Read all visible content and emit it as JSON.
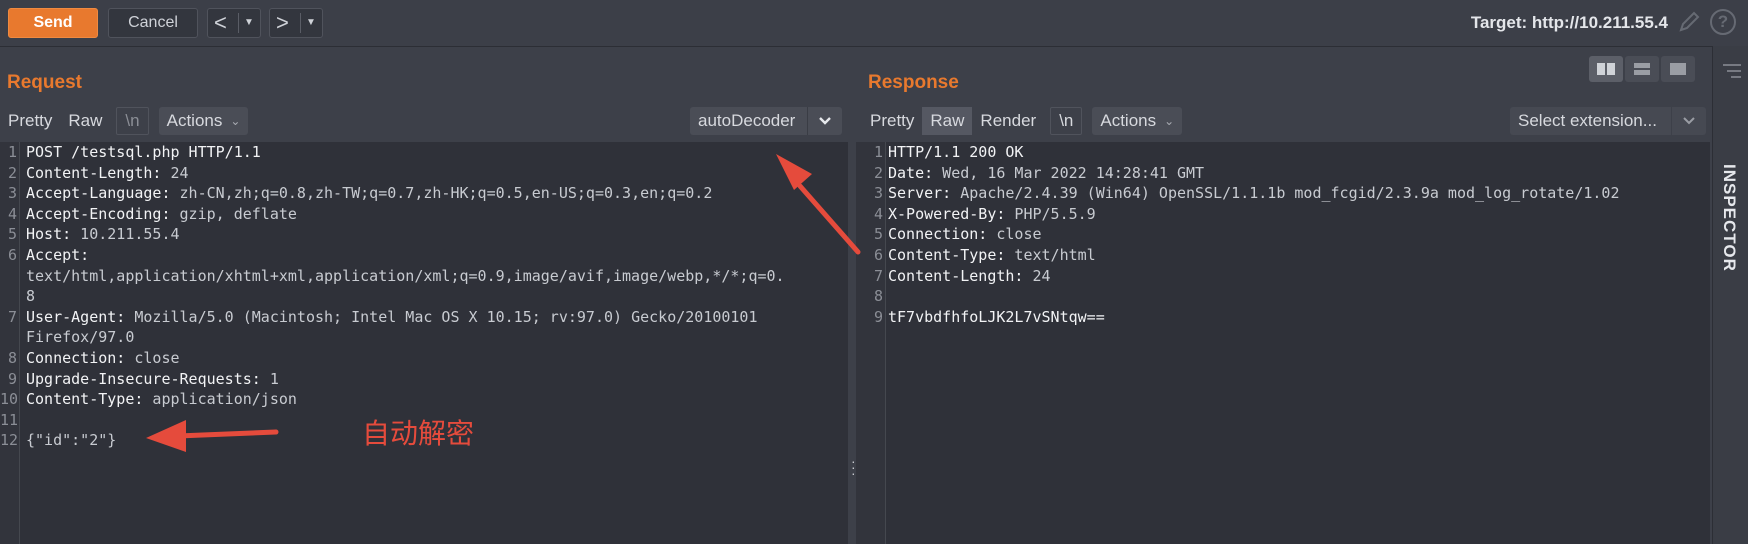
{
  "toolbar": {
    "send_label": "Send",
    "cancel_label": "Cancel",
    "back_glyph": "<",
    "forward_glyph": ">",
    "dropdown_glyph": "▼",
    "target_label": "Target: http://10.211.55.4",
    "help_glyph": "?"
  },
  "request": {
    "title": "Request",
    "tabs": [
      "Pretty",
      "Raw",
      "\\n"
    ],
    "actions_label": "Actions",
    "decoder_label": "autoDecoder",
    "lines": [
      {
        "n": "1",
        "key": "POST /testsql.php HTTP/1.1",
        "val": ""
      },
      {
        "n": "2",
        "key": "Content-Length:",
        "val": " 24"
      },
      {
        "n": "3",
        "key": "Accept-Language:",
        "val": " zh-CN,zh;q=0.8,zh-TW;q=0.7,zh-HK;q=0.5,en-US;q=0.3,en;q=0.2"
      },
      {
        "n": "4",
        "key": "Accept-Encoding:",
        "val": " gzip, deflate"
      },
      {
        "n": "5",
        "key": "Host:",
        "val": " 10.211.55.4"
      },
      {
        "n": "6",
        "key": "Accept:",
        "val": ""
      },
      {
        "n": "",
        "key": "",
        "val": "text/html,application/xhtml+xml,application/xml;q=0.9,image/avif,image/webp,*/*;q=0."
      },
      {
        "n": "",
        "key": "",
        "val": "8"
      },
      {
        "n": "7",
        "key": "User-Agent:",
        "val": " Mozilla/5.0 (Macintosh; Intel Mac OS X 10.15; rv:97.0) Gecko/20100101"
      },
      {
        "n": "",
        "key": "",
        "val": "Firefox/97.0"
      },
      {
        "n": "8",
        "key": "Connection:",
        "val": " close"
      },
      {
        "n": "9",
        "key": "Upgrade-Insecure-Requests:",
        "val": " 1"
      },
      {
        "n": "10",
        "key": "Content-Type:",
        "val": " application/json"
      },
      {
        "n": "11",
        "key": "",
        "val": ""
      },
      {
        "n": "12",
        "key": "",
        "val": "{\"id\":\"2\"}"
      }
    ]
  },
  "response": {
    "title": "Response",
    "tabs": [
      "Pretty",
      "Raw",
      "Render",
      "\\n"
    ],
    "active_tab": "Raw",
    "actions_label": "Actions",
    "extension_label": "Select extension...",
    "lines": [
      {
        "n": "1",
        "key": "HTTP/1.1 200 OK",
        "val": ""
      },
      {
        "n": "2",
        "key": "Date:",
        "val": " Wed, 16 Mar 2022 14:28:41 GMT"
      },
      {
        "n": "3",
        "key": "Server:",
        "val": " Apache/2.4.39 (Win64) OpenSSL/1.1.1b mod_fcgid/2.3.9a mod_log_rotate/1.02"
      },
      {
        "n": "4",
        "key": "X-Powered-By:",
        "val": " PHP/5.5.9"
      },
      {
        "n": "5",
        "key": "Connection:",
        "val": " close"
      },
      {
        "n": "6",
        "key": "Content-Type:",
        "val": " text/html"
      },
      {
        "n": "7",
        "key": "Content-Length:",
        "val": " 24"
      },
      {
        "n": "8",
        "key": "",
        "val": ""
      },
      {
        "n": "9",
        "key": "tF7vbdfhfoLJK2L7vSNtqw==",
        "val": ""
      }
    ]
  },
  "inspector": {
    "label": "INSPECTOR"
  },
  "annotation": {
    "text": "自动解密",
    "color": "#e54b3c"
  },
  "colors": {
    "accent": "#e8792e",
    "background": "#3d4049",
    "editor": "#2f3139"
  }
}
